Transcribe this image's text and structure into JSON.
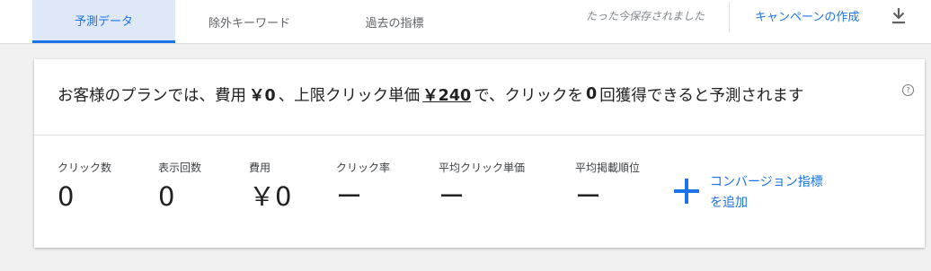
{
  "tabs": [
    {
      "label": "予測データ",
      "active": true
    },
    {
      "label": "除外キーワード",
      "active": false
    },
    {
      "label": "過去の指標",
      "active": false
    }
  ],
  "status": {
    "saved_text": "たった今保存されました"
  },
  "actions": {
    "create_campaign": "キャンペーンの作成",
    "download_icon": "download-icon"
  },
  "summary": {
    "p1": "お客様のプランでは、費用",
    "cost": "￥0",
    "p2": "、上限クリック単価",
    "max_cpc": "￥240",
    "p3": "で、クリックを",
    "clicks": "0",
    "p4": "回獲得できると予測されます",
    "help_icon": "?"
  },
  "metrics": [
    {
      "label": "クリック数",
      "value": "0"
    },
    {
      "label": "表示回数",
      "value": "0"
    },
    {
      "label": "費用",
      "value": "￥0"
    },
    {
      "label": "クリック率",
      "value": "ー"
    },
    {
      "label": "平均クリック単価",
      "value": "ー"
    },
    {
      "label": "平均掲載順位",
      "value": "ー"
    }
  ],
  "add_conversion": {
    "line1": "コンバージョン指標",
    "line2": "を追加"
  },
  "colors": {
    "accent": "#1a73e8",
    "active_tab_bg": "#dfe8f7",
    "page_bg": "#f1f1f1"
  }
}
